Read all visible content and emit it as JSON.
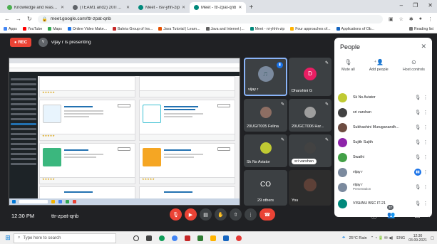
{
  "browser": {
    "tabs": [
      {
        "title": "Knowledge and reasoning ques",
        "color": "#4caf50",
        "active": false
      },
      {
        "title": "(TEAM1 and2) 20ITCS301 (Ge",
        "color": "#5f6368",
        "active": false
      },
      {
        "title": "Meet - rsv-yhh-zip",
        "color": "#00897b",
        "active": false
      },
      {
        "title": "Meet - ttr-zpat-qnb",
        "color": "#00897b",
        "active": true
      }
    ],
    "new_tab": "+",
    "url": "meet.google.com/ttr-zpat-qnb",
    "bookmarks": [
      {
        "label": "Apps",
        "color": "#4285f4"
      },
      {
        "label": "YouTube",
        "color": "#ff0000"
      },
      {
        "label": "Maps",
        "color": "#34a853"
      },
      {
        "label": "Online Video Make...",
        "color": "#1a73e8"
      },
      {
        "label": "Bahria Group of Ins...",
        "color": "#c62828"
      },
      {
        "label": "Java Tutorial | Learn...",
        "color": "#e65100"
      },
      {
        "label": "Java and Internet |...",
        "color": "#616161"
      },
      {
        "label": "Meet - ni-yhhh-zip",
        "color": "#00897b"
      },
      {
        "label": "Four approaches of...",
        "color": "#ffb300"
      },
      {
        "label": "Applications of Ob...",
        "color": "#1565c0"
      }
    ],
    "reading_list": "Reading list"
  },
  "meet": {
    "rec_label": "REC",
    "presenter_initials": "V",
    "presenting_text": "vijay r is presenting",
    "tiles": [
      {
        "name": "vijay r",
        "initial": "",
        "color": "#7b8a9e"
      },
      {
        "name": "Dharshini G",
        "initial": "D",
        "color": "#e91e63"
      },
      {
        "name": "20UGIT005 Felina",
        "initial": "",
        "color": "#8d6e63"
      },
      {
        "name": "20UGCT006 Har...",
        "initial": "",
        "color": "#9e9e9e"
      },
      {
        "name": "Sk Ns Aviator",
        "initial": "",
        "color": "#c0ca33"
      },
      {
        "name": "sri varshan",
        "initial": "",
        "color": "#424242"
      },
      {
        "name": "29 others",
        "initial": "CO",
        "color": "#3c4043"
      },
      {
        "name": "You",
        "initial": "",
        "color": "#5d4037"
      }
    ],
    "clock": "12:30 PM",
    "meeting_code": "ttr-zpat-qnb",
    "participant_count": "37"
  },
  "people": {
    "title": "People",
    "actions": [
      {
        "label": "Mute all",
        "icon": "mic-off-icon"
      },
      {
        "label": "Add people",
        "icon": "add-person-icon"
      },
      {
        "label": "Host controls",
        "icon": "host-controls-icon"
      }
    ],
    "participants": [
      {
        "name": "Sk Ns Aviator",
        "sub": "",
        "color": "#c0ca33",
        "speaking": false
      },
      {
        "name": "sri varshan",
        "sub": "",
        "color": "#424242",
        "speaking": false
      },
      {
        "name": "Subhashini Muruganandh...",
        "sub": "",
        "color": "#6d4c41",
        "speaking": false
      },
      {
        "name": "Sujith Sujith",
        "sub": "",
        "color": "#8e24aa",
        "speaking": false
      },
      {
        "name": "Swathi",
        "sub": "",
        "color": "#43a047",
        "speaking": false
      },
      {
        "name": "vijay r",
        "sub": "",
        "color": "#7b8a9e",
        "speaking": true
      },
      {
        "name": "vijay r",
        "sub": "Presentation",
        "color": "#7b8a9e",
        "speaking": false
      },
      {
        "name": "VISHNU BSC IT-21",
        "sub": "",
        "color": "#00897b",
        "speaking": false
      }
    ]
  },
  "windows": {
    "search_placeholder": "Type here to search",
    "weather": "25°C Rain",
    "language": "ENG",
    "time": "12:30",
    "date": "03-09-2021"
  }
}
